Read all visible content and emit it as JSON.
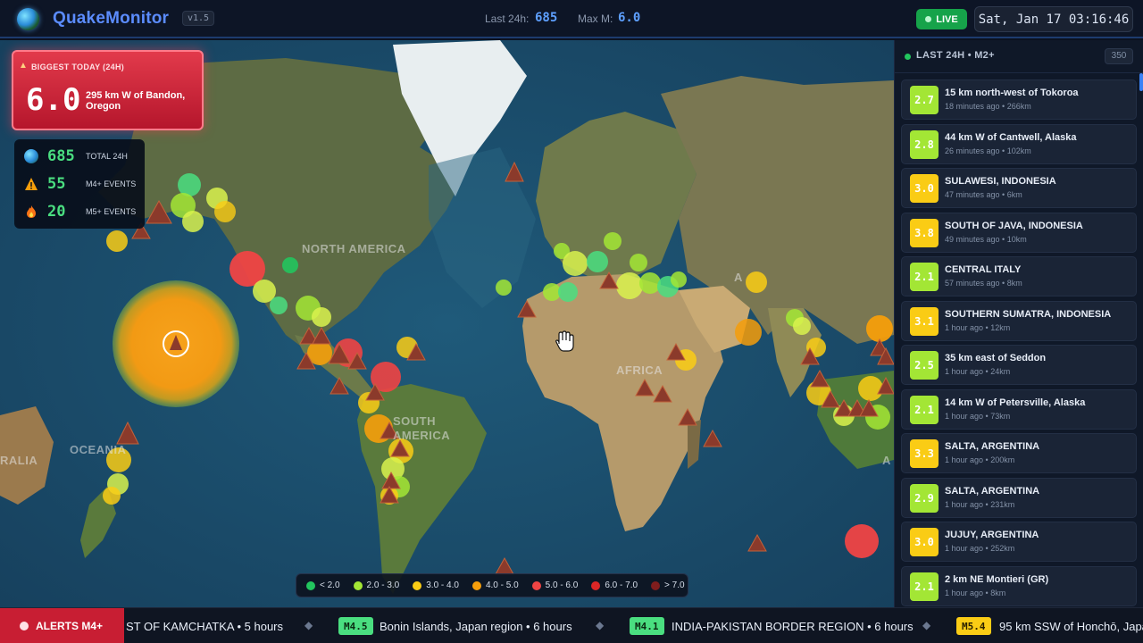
{
  "header": {
    "app_name": "QuakeMonitor",
    "version": "v1.5",
    "last24_label": "Last 24h:",
    "last24_value": "685",
    "maxm_label": "Max M:",
    "maxm_value": "6.0",
    "live_label": "LIVE",
    "clock": "Sat, Jan 17 03:16:46"
  },
  "map": {
    "labels": {
      "north_america": "NORTH AMERICA",
      "south_america": "SOUTH AMERICA",
      "africa": "AFRICA",
      "oceania": "OCEANIA",
      "australia": "RALIA",
      "asia_edge": "A",
      "aus_edge": "A"
    },
    "biggest": {
      "label": "BIGGEST TODAY (24H)",
      "magnitude": "6.0",
      "place": "295 km W of Bandon, Oregon"
    },
    "stats": [
      {
        "icon": "globe-icon",
        "value": "685",
        "label": "TOTAL 24H"
      },
      {
        "icon": "warning-icon",
        "value": "55",
        "label": "M4+ EVENTS"
      },
      {
        "icon": "fire-icon",
        "value": "20",
        "label": "M5+ EVENTS"
      }
    ],
    "legend": [
      {
        "label": "< 2.0",
        "color": "#22c55e"
      },
      {
        "label": "2.0 - 3.0",
        "color": "#a3e635"
      },
      {
        "label": "3.0 - 4.0",
        "color": "#facc15"
      },
      {
        "label": "4.0 - 5.0",
        "color": "#f59e0b"
      },
      {
        "label": "5.0 - 6.0",
        "color": "#ef4444"
      },
      {
        "label": "6.0 - 7.0",
        "color": "#dc2626"
      },
      {
        "label": "> 7.0",
        "color": "#7f1d1d"
      }
    ]
  },
  "panel": {
    "title": "LAST 24H • M2+",
    "count": "350",
    "items": [
      {
        "mag": "2.7",
        "place": "15 km north-west of Tokoroa",
        "meta": "18 minutes ago • 266km",
        "color": "#a3e635"
      },
      {
        "mag": "2.8",
        "place": "44 km W of Cantwell, Alaska",
        "meta": "26 minutes ago • 102km",
        "color": "#a3e635"
      },
      {
        "mag": "3.0",
        "place": "SULAWESI, INDONESIA",
        "meta": "47 minutes ago • 6km",
        "color": "#facc15"
      },
      {
        "mag": "3.8",
        "place": "SOUTH OF JAVA, INDONESIA",
        "meta": "49 minutes ago • 10km",
        "color": "#facc15"
      },
      {
        "mag": "2.1",
        "place": "CENTRAL ITALY",
        "meta": "57 minutes ago • 8km",
        "color": "#a3e635"
      },
      {
        "mag": "3.1",
        "place": "SOUTHERN SUMATRA, INDONESIA",
        "meta": "1 hour ago • 12km",
        "color": "#facc15"
      },
      {
        "mag": "2.5",
        "place": "35 km east of Seddon",
        "meta": "1 hour ago • 24km",
        "color": "#a3e635"
      },
      {
        "mag": "2.1",
        "place": "14 km W of Petersville, Alaska",
        "meta": "1 hour ago • 73km",
        "color": "#a3e635"
      },
      {
        "mag": "3.3",
        "place": "SALTA, ARGENTINA",
        "meta": "1 hour ago • 200km",
        "color": "#facc15"
      },
      {
        "mag": "2.9",
        "place": "SALTA, ARGENTINA",
        "meta": "1 hour ago • 231km",
        "color": "#a3e635"
      },
      {
        "mag": "3.0",
        "place": "JUJUY, ARGENTINA",
        "meta": "1 hour ago • 252km",
        "color": "#facc15"
      },
      {
        "mag": "2.1",
        "place": "2 km NE Montieri (GR)",
        "meta": "1 hour ago • 8km",
        "color": "#a3e635"
      }
    ]
  },
  "ticker": {
    "alerts_label": "ALERTS M4+",
    "items": [
      {
        "mag": "",
        "text": "ST OF KAMCHATKA • 5 hours",
        "color": ""
      },
      {
        "mag": "M4.5",
        "text": "Bonin Islands, Japan region • 6 hours",
        "color": "#4ade80"
      },
      {
        "mag": "M4.1",
        "text": "INDIA-PAKISTAN BORDER REGION • 6 hours",
        "color": "#4ade80"
      },
      {
        "mag": "M5.4",
        "text": "95 km SSW of Honchō, Japa",
        "color": "#facc15"
      }
    ]
  }
}
